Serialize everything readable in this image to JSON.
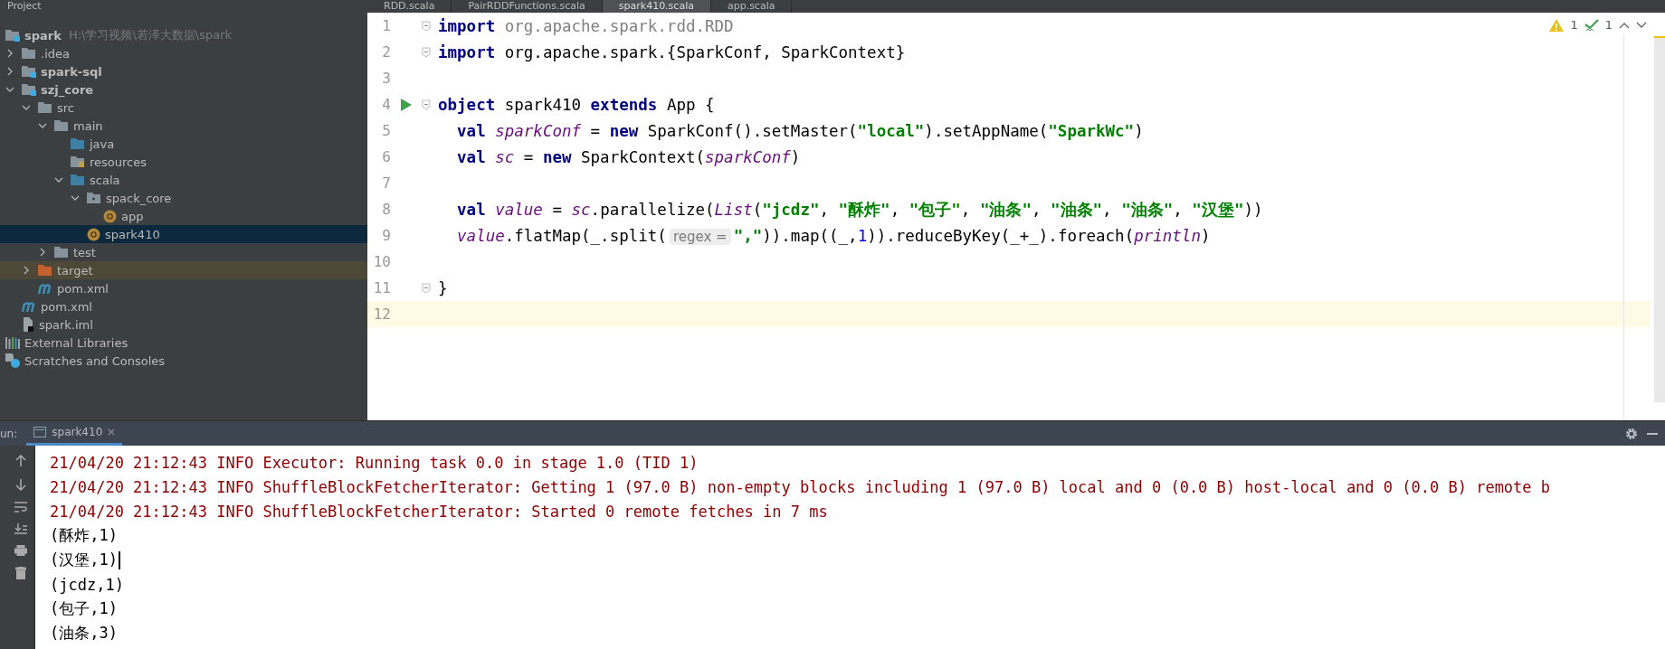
{
  "project_panel": {
    "title": "Project",
    "tree": [
      {
        "label": "spark",
        "path_hint": "H:\\学习视频\\若泽大数据\\spark",
        "kind": "module",
        "selected": false,
        "children": [
          {
            "label": ".idea",
            "kind": "folder",
            "expanded": false,
            "selected": false
          },
          {
            "label": "spark-sql",
            "kind": "module",
            "expanded": false,
            "selected": false
          },
          {
            "label": "szj_core",
            "kind": "module",
            "expanded": true,
            "selected": false,
            "children": [
              {
                "label": "src",
                "kind": "folder",
                "expanded": true,
                "selected": false,
                "children": [
                  {
                    "label": "main",
                    "kind": "folder",
                    "expanded": true,
                    "selected": false,
                    "children": [
                      {
                        "label": "java",
                        "kind": "source-folder",
                        "selected": false
                      },
                      {
                        "label": "resources",
                        "kind": "resources-folder",
                        "selected": false
                      },
                      {
                        "label": "scala",
                        "kind": "source-folder",
                        "expanded": true,
                        "selected": false,
                        "children": [
                          {
                            "label": "spack_core",
                            "kind": "package",
                            "expanded": true,
                            "selected": false,
                            "children": [
                              {
                                "label": "app",
                                "kind": "scala-object",
                                "selected": false
                              }
                            ]
                          },
                          {
                            "label": "spark410",
                            "kind": "scala-object",
                            "selected": true
                          }
                        ]
                      }
                    ]
                  },
                  {
                    "label": "test",
                    "kind": "folder",
                    "expanded": false,
                    "selected": false
                  }
                ]
              },
              {
                "label": "target",
                "kind": "excluded-folder",
                "expanded": false,
                "selected": false
              },
              {
                "label": "pom.xml",
                "kind": "maven",
                "selected": false
              }
            ]
          },
          {
            "label": "pom.xml",
            "kind": "maven",
            "selected": false
          },
          {
            "label": "spark.iml",
            "kind": "iml",
            "selected": false
          }
        ]
      },
      {
        "label": "External Libraries",
        "kind": "libraries",
        "selected": false
      },
      {
        "label": "Scratches and Consoles",
        "kind": "scratches",
        "selected": false
      }
    ]
  },
  "editor_tabs": [
    {
      "label": "RDD.scala",
      "selected": false
    },
    {
      "label": "PairRDDFunctions.scala",
      "selected": false
    },
    {
      "label": "spark410.scala",
      "selected": true
    },
    {
      "label": "app.scala",
      "selected": false
    }
  ],
  "inspections": {
    "warnings": "1",
    "typos": "1"
  },
  "editor_lines": [
    {
      "number": "1",
      "fold": true,
      "run": false,
      "current": false,
      "tokens": [
        {
          "kind": "kw",
          "text": "import"
        },
        {
          "kind": "dim",
          "text": " org.apache.spark.rdd.RDD"
        }
      ]
    },
    {
      "number": "2",
      "fold": true,
      "run": false,
      "current": false,
      "tokens": [
        {
          "kind": "kw",
          "text": "import"
        },
        {
          "kind": "plain",
          "text": " org.apache.spark.{SparkConf, SparkContext}"
        }
      ]
    },
    {
      "number": "3",
      "fold": false,
      "run": false,
      "current": false
    },
    {
      "number": "4",
      "fold": true,
      "run": true,
      "current": false,
      "tokens": [
        {
          "kind": "kw",
          "text": "object"
        },
        {
          "kind": "plain",
          "text": " spark410 "
        },
        {
          "kind": "kw",
          "text": "extends"
        },
        {
          "kind": "plain",
          "text": " App {"
        }
      ]
    },
    {
      "number": "5",
      "fold": false,
      "run": false,
      "current": false,
      "tokens": [
        {
          "kind": "kw",
          "text": "  val "
        },
        {
          "kind": "ital",
          "text": "sparkConf"
        },
        {
          "kind": "plain",
          "text": " = "
        },
        {
          "kind": "kw",
          "text": "new"
        },
        {
          "kind": "plain",
          "text": " SparkConf().setMaster("
        },
        {
          "kind": "str",
          "text": "\"local\""
        },
        {
          "kind": "plain",
          "text": ").setAppName("
        },
        {
          "kind": "str",
          "text": "\"SparkWc\""
        },
        {
          "kind": "plain",
          "text": ")"
        }
      ]
    },
    {
      "number": "6",
      "fold": false,
      "run": false,
      "current": false,
      "tokens": [
        {
          "kind": "kw",
          "text": "  val "
        },
        {
          "kind": "ital",
          "text": "sc"
        },
        {
          "kind": "plain",
          "text": " = "
        },
        {
          "kind": "kw",
          "text": "new"
        },
        {
          "kind": "plain",
          "text": " SparkContext("
        },
        {
          "kind": "ital",
          "text": "sparkConf"
        },
        {
          "kind": "plain",
          "text": ")"
        }
      ]
    },
    {
      "number": "7",
      "fold": false,
      "run": false,
      "current": false
    },
    {
      "number": "8",
      "fold": false,
      "run": false,
      "current": false,
      "tokens": [
        {
          "kind": "kw",
          "text": "  val "
        },
        {
          "kind": "ital",
          "text": "value"
        },
        {
          "kind": "plain",
          "text": " = "
        },
        {
          "kind": "ital",
          "text": "sc"
        },
        {
          "kind": "plain",
          "text": ".parallelize("
        },
        {
          "kind": "ital",
          "text": "List"
        },
        {
          "kind": "plain",
          "text": "("
        },
        {
          "kind": "str",
          "text": "\"jcdz\""
        },
        {
          "kind": "plain",
          "text": ", "
        },
        {
          "kind": "str",
          "text": "\"酥炸\""
        },
        {
          "kind": "plain",
          "text": ", "
        },
        {
          "kind": "str",
          "text": "\"包子\""
        },
        {
          "kind": "plain",
          "text": ", "
        },
        {
          "kind": "str",
          "text": "\"油条\""
        },
        {
          "kind": "plain",
          "text": ", "
        },
        {
          "kind": "str",
          "text": "\"油条\""
        },
        {
          "kind": "plain",
          "text": ", "
        },
        {
          "kind": "str",
          "text": "\"油条\""
        },
        {
          "kind": "plain",
          "text": ", "
        },
        {
          "kind": "str",
          "text": "\"汉堡\""
        },
        {
          "kind": "plain",
          "text": "))"
        }
      ]
    },
    {
      "number": "9",
      "fold": false,
      "run": false,
      "current": false,
      "tokens": [
        {
          "kind": "ital",
          "text": "  value"
        },
        {
          "kind": "plain",
          "text": ".flatMap(_.split("
        },
        {
          "kind": "hint",
          "text": "regex ="
        },
        {
          "kind": "str",
          "text": "\",\""
        },
        {
          "kind": "plain",
          "text": ")).map((_,"
        },
        {
          "kind": "num",
          "text": "1"
        },
        {
          "kind": "plain",
          "text": ")).reduceByKey(_+_).foreach("
        },
        {
          "kind": "ital",
          "text": "println"
        },
        {
          "kind": "plain",
          "text": ")"
        }
      ]
    },
    {
      "number": "10",
      "fold": false,
      "run": false,
      "current": false
    },
    {
      "number": "11",
      "fold": true,
      "run": false,
      "current": false,
      "tokens": [
        {
          "kind": "plain",
          "text": "}"
        }
      ]
    },
    {
      "number": "12",
      "fold": false,
      "run": false,
      "current": true
    }
  ],
  "run_panel": {
    "label": "un:",
    "tab": "spark410",
    "console": [
      {
        "kind": "log",
        "text": "21/04/20 21:12:43 INFO Executor: Running task 0.0 in stage 1.0 (TID 1)"
      },
      {
        "kind": "log",
        "text": "21/04/20 21:12:43 INFO ShuffleBlockFetcherIterator: Getting 1 (97.0 B) non-empty blocks including 1 (97.0 B) local and 0 (0.0 B) host-local and 0 (0.0 B) remote b"
      },
      {
        "kind": "log",
        "text": "21/04/20 21:12:43 INFO ShuffleBlockFetcherIterator: Started 0 remote fetches in 7 ms"
      },
      {
        "kind": "out",
        "text": "(酥炸,1)",
        "cursor": false
      },
      {
        "kind": "out",
        "text": "(汉堡,1)",
        "cursor": true
      },
      {
        "kind": "out",
        "text": "(jcdz,1)",
        "cursor": false
      },
      {
        "kind": "out",
        "text": "(包子,1)",
        "cursor": false
      },
      {
        "kind": "out",
        "text": "(油条,3)",
        "cursor": false
      }
    ]
  }
}
